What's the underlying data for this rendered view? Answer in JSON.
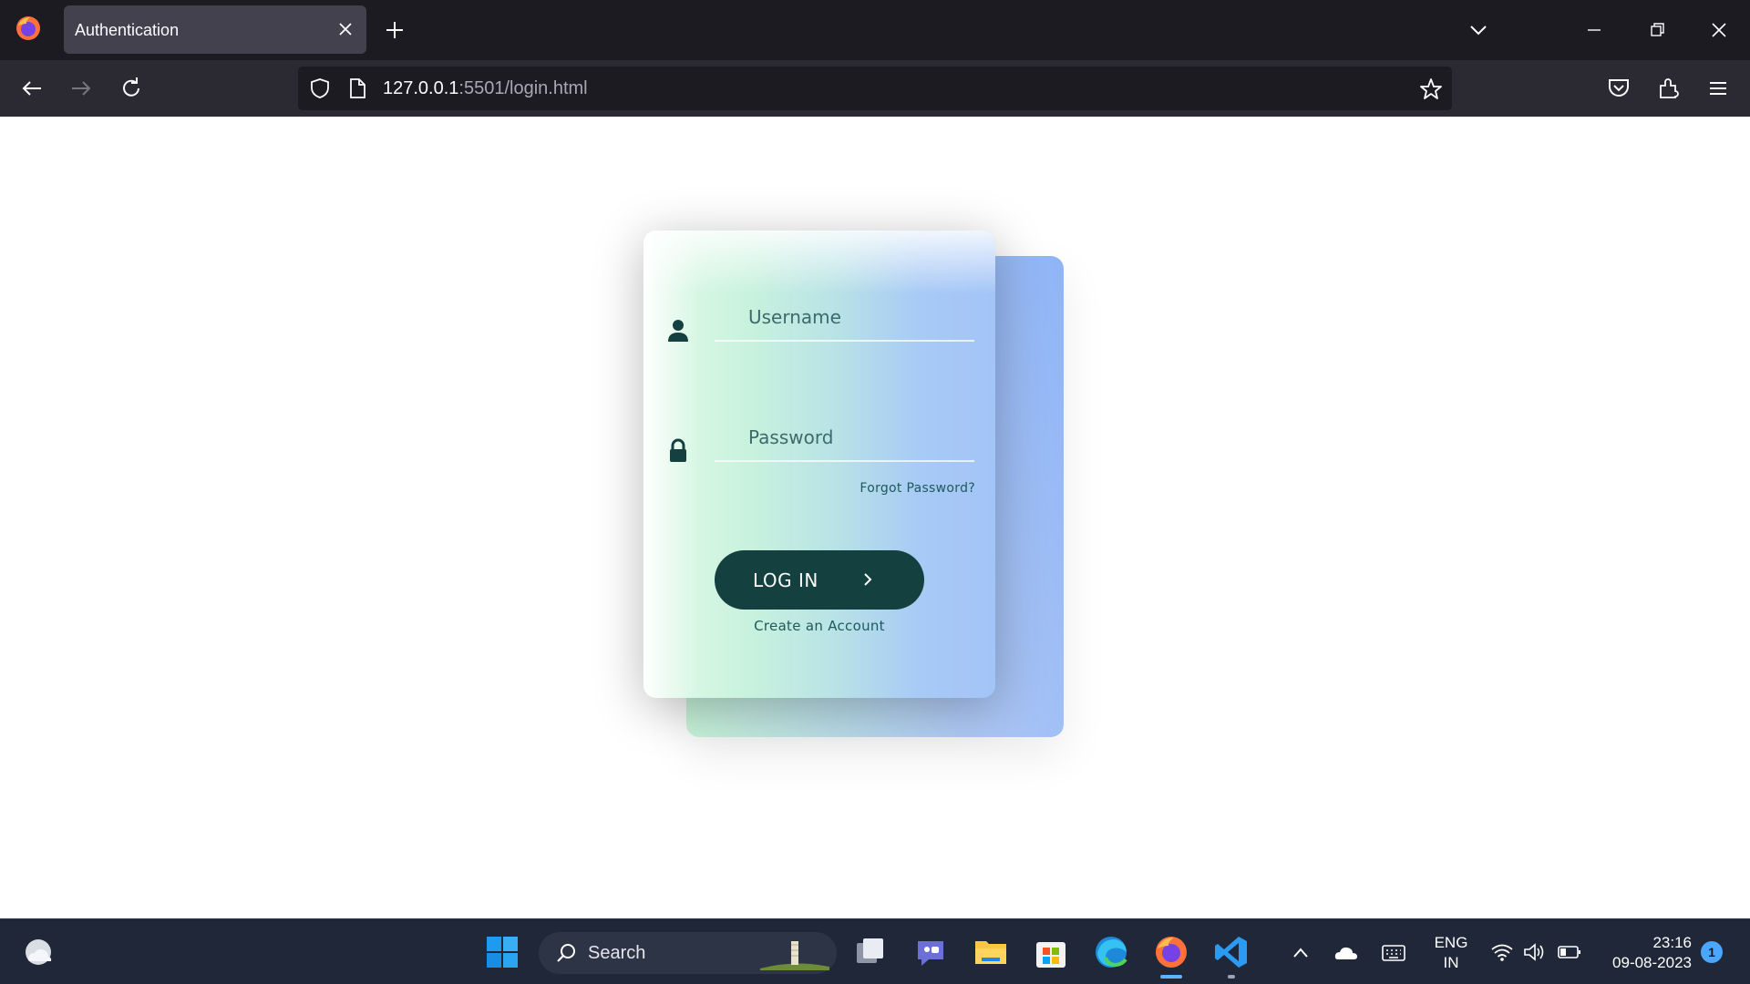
{
  "browser": {
    "tab_title": "Authentication",
    "url_host": "127.0.0.1",
    "url_path": ":5501/login.html"
  },
  "login": {
    "username_placeholder": "Username",
    "password_placeholder": "Password",
    "forgot_link": "Forgot Password?",
    "login_button": "LOG IN",
    "create_account_link": "Create an Account"
  },
  "taskbar": {
    "search_label": "Search",
    "language_line1": "ENG",
    "language_line2": "IN",
    "time": "23:16",
    "date": "09-08-2023",
    "notification_count": "1"
  },
  "colors": {
    "login_button": "#14403f",
    "card_gradient_start": "#c8f2dd",
    "card_gradient_end": "#a3c4f7",
    "browser_chrome": "#1c1b22",
    "taskbar": "#1f2738"
  },
  "icons": [
    "firefox-icon",
    "close-icon",
    "plus-icon",
    "chevron-down-icon",
    "minimize-icon",
    "restore-icon",
    "back-icon",
    "forward-icon",
    "reload-icon",
    "shield-icon",
    "page-icon",
    "star-icon",
    "pocket-icon",
    "extensions-icon",
    "menu-icon",
    "user-icon",
    "lock-icon",
    "chevron-right-icon",
    "weather-icon",
    "windows-start-icon",
    "search-icon",
    "task-view-icon",
    "chat-icon",
    "file-explorer-icon",
    "store-icon",
    "edge-icon",
    "vscode-icon",
    "chevron-up-icon",
    "cloud-icon",
    "keyboard-icon",
    "wifi-icon",
    "volume-icon",
    "battery-icon"
  ]
}
